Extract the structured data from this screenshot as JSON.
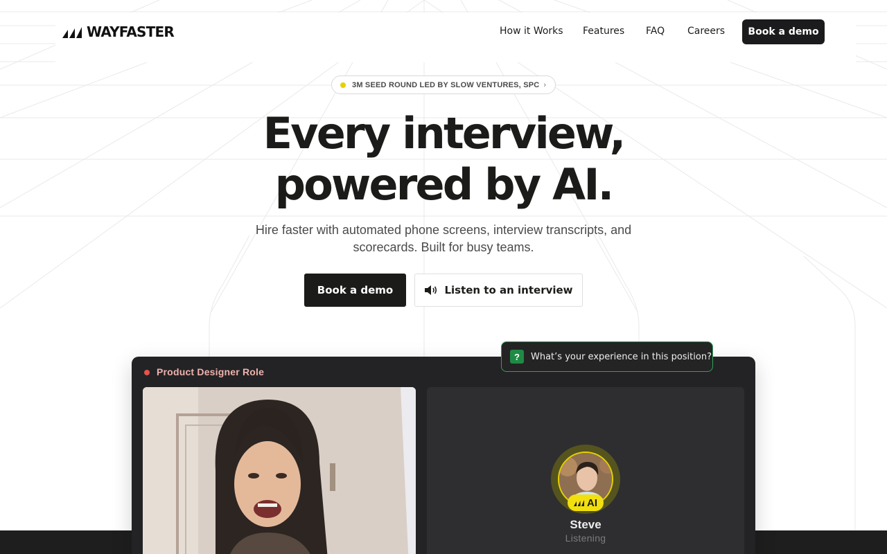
{
  "brand": {
    "name": "WAYFASTER",
    "logo_icon": "wayfaster-logo-icon"
  },
  "nav": {
    "links": [
      {
        "label": "How it Works"
      },
      {
        "label": "Features"
      },
      {
        "label": "FAQ"
      },
      {
        "label": "Careers"
      }
    ],
    "cta_label": "Book a demo"
  },
  "announcement": {
    "text": "3M SEED ROUND LED BY SLOW VENTURES, SPC",
    "chevron": "›",
    "dot_color": "#e6d100"
  },
  "hero": {
    "title_line1": "Every interview,",
    "title_line2": "powered by AI.",
    "subtitle": "Hire faster with automated phone screens, interview transcripts, and scorecards. Built for busy teams.",
    "primary_cta": "Book a demo",
    "secondary_cta": "Listen to an interview",
    "secondary_icon": "speaker-icon"
  },
  "interview_demo": {
    "role_label": "Product Designer Role",
    "role_dot_color": "#e5534b",
    "question_icon": "?",
    "question": "What’s your experience in this position?",
    "ai_badge": "AI",
    "ai_name": "Steve",
    "ai_status": "Listening"
  },
  "colors": {
    "dark": "#1b1b19",
    "panel": "#232325",
    "accent_yellow": "#f2df0e",
    "accent_green": "#2fa35a"
  }
}
